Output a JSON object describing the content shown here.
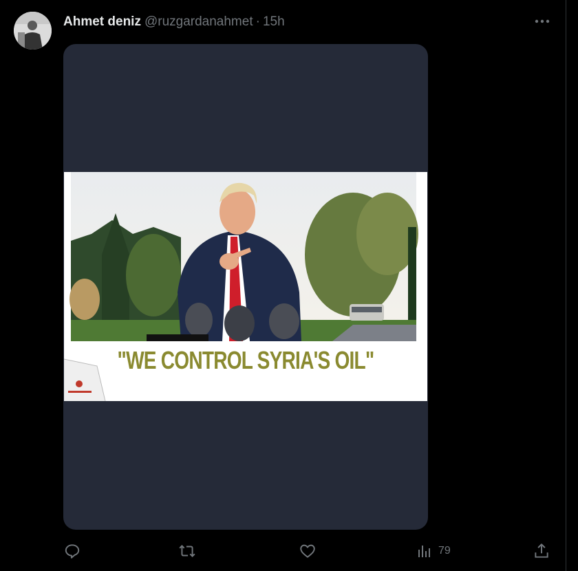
{
  "tweet": {
    "author_name": "Ahmet deniz",
    "handle": "@ruzgardanahmet",
    "separator": "·",
    "time": "15h",
    "more_icon": "more-horizontal-icon",
    "image_caption": "\"WE CONTROL SYRIA'S OIL\"",
    "actions": {
      "reply_icon": "reply-icon",
      "retweet_icon": "retweet-icon",
      "like_icon": "heart-icon",
      "views_icon": "views-icon",
      "views_count": "79",
      "share_icon": "share-icon"
    }
  },
  "colors": {
    "background": "#000000",
    "text": "#e7e9ea",
    "secondary": "#71767b",
    "media_bg": "#252a38",
    "caption": "#8a8a30"
  }
}
